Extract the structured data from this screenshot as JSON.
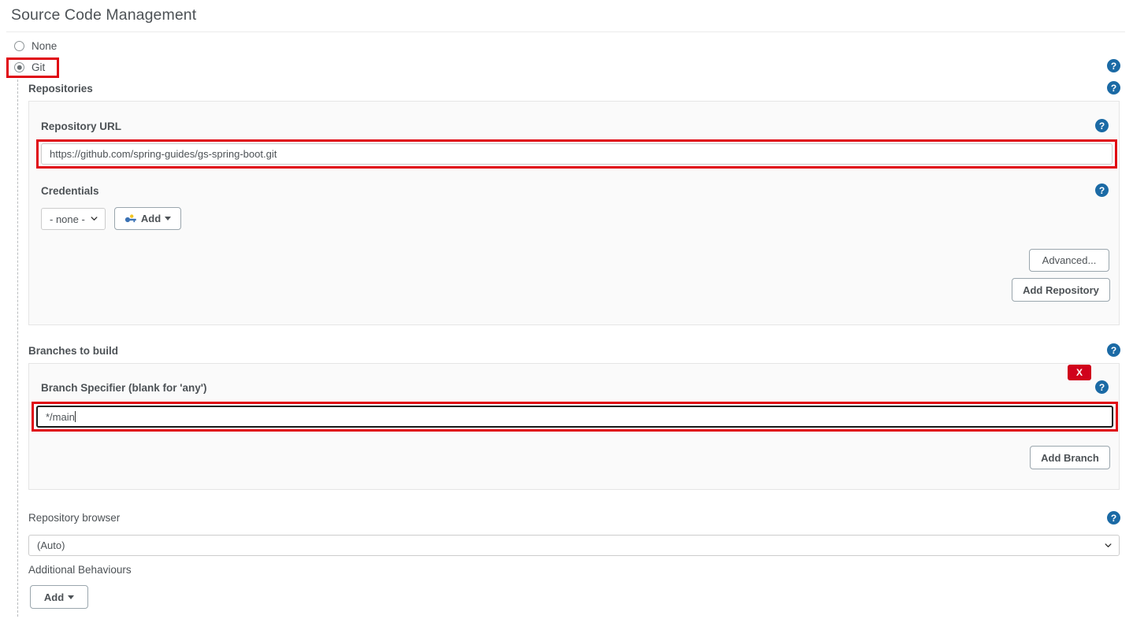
{
  "page": {
    "title": "Source Code Management"
  },
  "scm_options": [
    {
      "label": "None",
      "selected": false
    },
    {
      "label": "Git",
      "selected": true
    }
  ],
  "repositories": {
    "section_label": "Repositories",
    "repository_url": {
      "label": "Repository URL",
      "value": "https://github.com/spring-guides/gs-spring-boot.git"
    },
    "credentials": {
      "label": "Credentials",
      "selected": "- none -",
      "add_button": "Add",
      "add_icon": "key-icon"
    },
    "advanced_button": "Advanced...",
    "add_repository_button": "Add Repository"
  },
  "branches": {
    "section_label": "Branches to build",
    "delete_button": "X",
    "branch_specifier": {
      "label": "Branch Specifier (blank for 'any')",
      "value": "*/main"
    },
    "add_branch_button": "Add Branch"
  },
  "repository_browser": {
    "label": "Repository browser",
    "selected": "(Auto)"
  },
  "additional_behaviours": {
    "label": "Additional Behaviours",
    "add_button": "Add"
  },
  "help_icon": "?",
  "colors": {
    "annotation_red": "#e00712",
    "delete_red": "#d0021b",
    "help_blue": "#1b6aa5",
    "text": "#4d5256",
    "panel_bg": "#fafafa"
  }
}
